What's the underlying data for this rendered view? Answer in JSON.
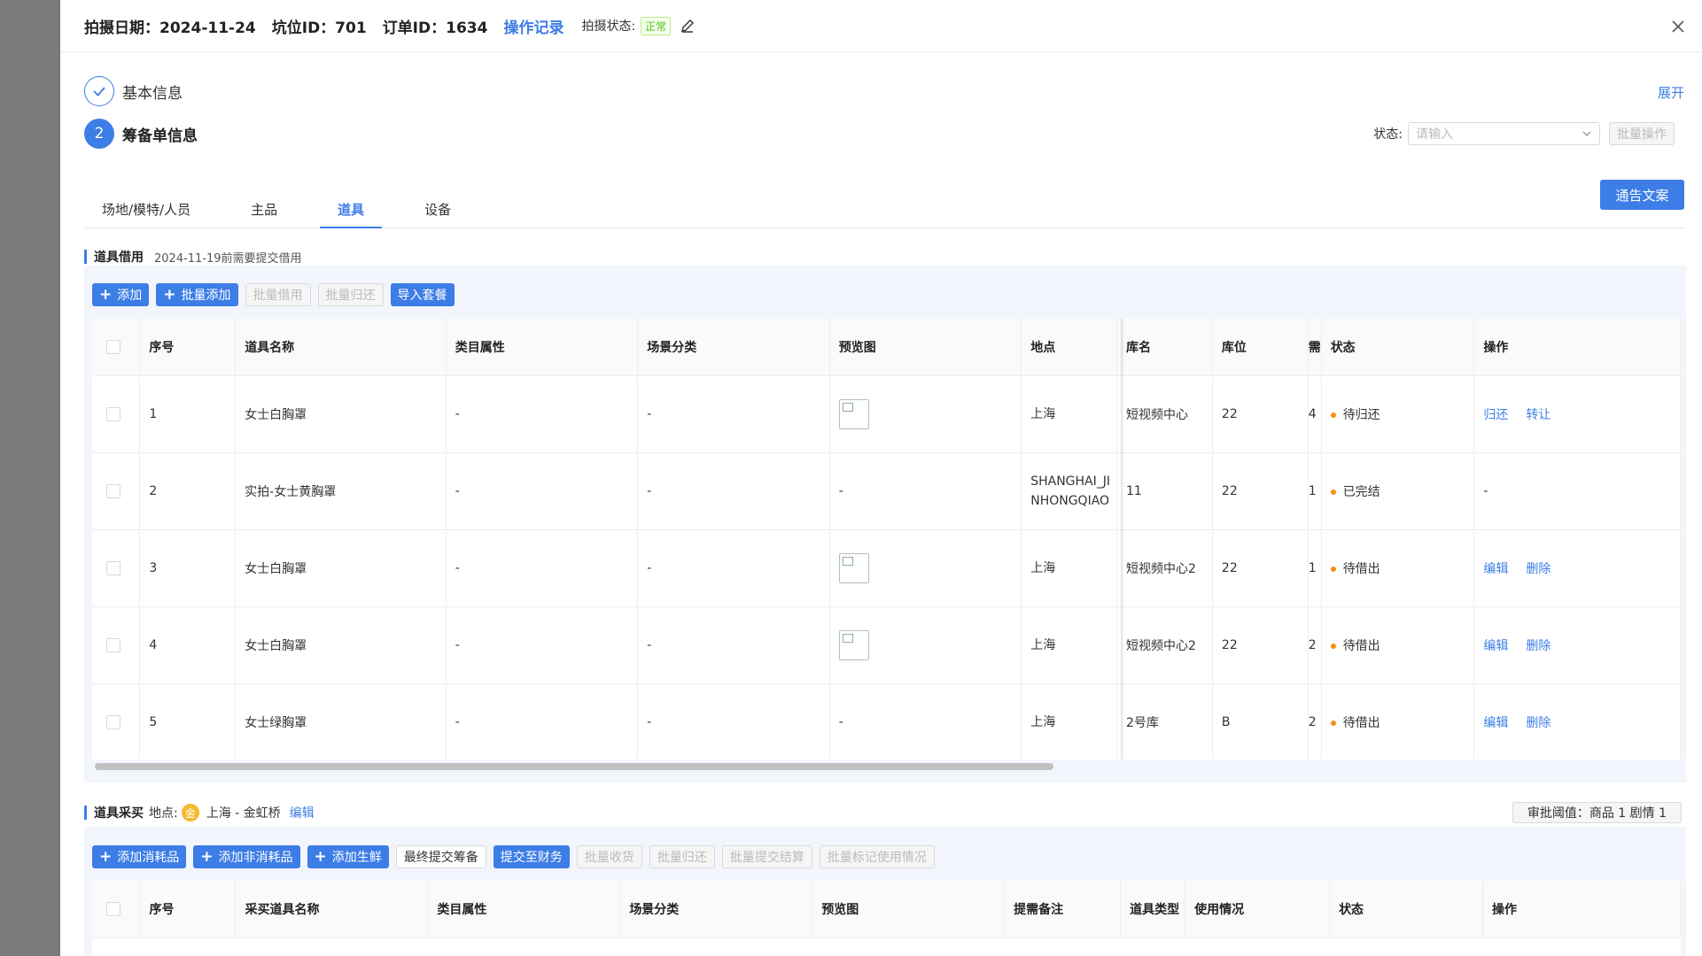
{
  "header": {
    "shoot_date": "拍摄日期：2024-11-24",
    "slot_id": "坑位ID：701",
    "order_id": "订单ID：1634",
    "op_log": "操作记录",
    "shoot_status_label": "拍摄状态:",
    "shoot_status": "正常"
  },
  "steps": {
    "step1": "基本信息",
    "step2_num": "2",
    "step2": "筹备单信息",
    "expand": "展开"
  },
  "filter": {
    "label": "状态:",
    "placeholder": "请输入",
    "batch_op": "批量操作"
  },
  "tabs": [
    "场地/模特/人员",
    "主品",
    "道具",
    "设备"
  ],
  "notice_button": "通告文案",
  "borrow": {
    "title": "道具借用",
    "deadline": "2024-11-19前需要提交借用",
    "buttons": {
      "add": "添加",
      "batch_add": "批量添加",
      "batch_borrow": "批量借用",
      "batch_return": "批量归还",
      "import_pkg": "导入套餐"
    },
    "columns": [
      "序号",
      "道具名称",
      "类目属性",
      "场景分类",
      "预览图",
      "地点",
      "库名",
      "库位",
      "需",
      "状态",
      "操作"
    ],
    "rows": [
      {
        "no": "1",
        "name": "女士白胸罩",
        "cat": "-",
        "scene": "-",
        "preview": true,
        "preview_text": "",
        "loc": "上海",
        "lib": "短视频中心",
        "pos": "22",
        "qty": "4",
        "status": "待归还",
        "ops": [
          "归还",
          "转让"
        ]
      },
      {
        "no": "2",
        "name": "实拍-女士黄胸罩",
        "cat": "-",
        "scene": "-",
        "preview": false,
        "preview_text": "-",
        "loc": "SHANGHAI_JINHONGQIAO",
        "lib": "11",
        "pos": "22",
        "qty": "1",
        "status": "已完结",
        "ops": [
          "-"
        ]
      },
      {
        "no": "3",
        "name": "女士白胸罩",
        "cat": "-",
        "scene": "-",
        "preview": true,
        "preview_text": "",
        "loc": "上海",
        "lib": "短视频中心2",
        "pos": "22",
        "qty": "1",
        "status": "待借出",
        "ops": [
          "编辑",
          "删除"
        ]
      },
      {
        "no": "4",
        "name": "女士白胸罩",
        "cat": "-",
        "scene": "-",
        "preview": true,
        "preview_text": "",
        "loc": "上海",
        "lib": "短视频中心2",
        "pos": "22",
        "qty": "2",
        "status": "待借出",
        "ops": [
          "编辑",
          "删除"
        ]
      },
      {
        "no": "5",
        "name": "女士绿胸罩",
        "cat": "-",
        "scene": "-",
        "preview": false,
        "preview_text": "-",
        "loc": "上海",
        "lib": "2号库",
        "pos": "B",
        "qty": "2",
        "status": "待借出",
        "ops": [
          "编辑",
          "删除"
        ]
      }
    ]
  },
  "purchase": {
    "title": "道具采买",
    "location_label": "地点:",
    "location_icon": "金",
    "location": "上海 - 金虹桥",
    "edit": "编辑",
    "threshold": "审批阈值：商品 1 剧情 1",
    "buttons": {
      "add_consumable": "添加消耗品",
      "add_nonconsumable": "添加非消耗品",
      "add_fresh": "添加生鲜",
      "final_submit": "最终提交筹备",
      "submit_finance": "提交至财务",
      "batch_receive": "批量收货",
      "batch_return": "批量归还",
      "batch_settle": "批量提交结算",
      "batch_mark": "批量标记使用情况"
    },
    "columns": [
      "序号",
      "采买道具名称",
      "类目属性",
      "场景分类",
      "预览图",
      "提需备注",
      "道具类型",
      "使用情况",
      "状态",
      "操作"
    ]
  },
  "colors": {
    "primary": "#3d7de6",
    "status_dot": "#fa8c16",
    "ok": "#52c41a"
  }
}
